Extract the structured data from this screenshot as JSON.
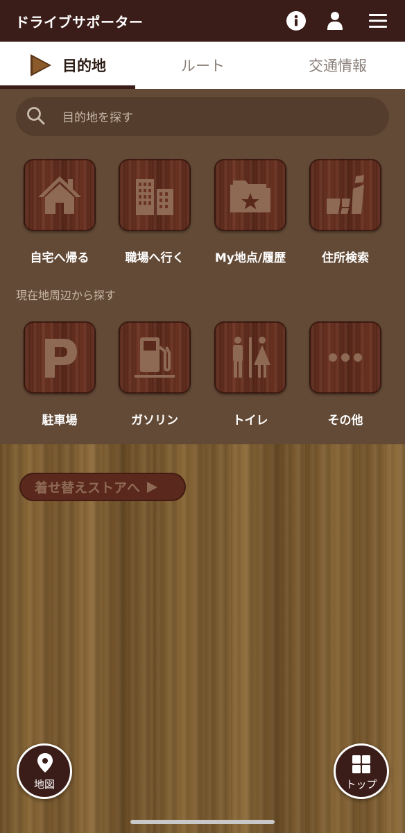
{
  "header": {
    "title": "ドライブサポーター",
    "icons": [
      "info-icon",
      "user-icon",
      "menu-icon"
    ]
  },
  "tabs": [
    {
      "label": "目的地",
      "selected": true
    },
    {
      "label": "ルート",
      "selected": false
    },
    {
      "label": "交通情報",
      "selected": false
    }
  ],
  "search": {
    "placeholder": "目的地を探す"
  },
  "quick_menu": [
    {
      "label": "自宅へ帰る",
      "icon": "house-icon"
    },
    {
      "label": "職場へ行く",
      "icon": "office-building-icon"
    },
    {
      "label": "My地点/履歴",
      "icon": "folder-star-icon"
    },
    {
      "label": "住所検索",
      "icon": "address-map-icon"
    }
  ],
  "nearby": {
    "section_label": "現在地周辺から探す",
    "items": [
      {
        "label": "駐車場",
        "icon": "parking-icon"
      },
      {
        "label": "ガソリン",
        "icon": "gas-station-icon"
      },
      {
        "label": "トイレ",
        "icon": "restroom-icon"
      },
      {
        "label": "その他",
        "icon": "more-icon"
      }
    ]
  },
  "store_button": {
    "label": "着せ替えストアへ"
  },
  "bottom": {
    "map_label": "地図",
    "top_label": "トップ"
  },
  "colors": {
    "header_bg": "#3a1c18",
    "panel_bg": "#634a36",
    "tile_wood": "#6e3423",
    "icon_engrave": "#8e6a55"
  }
}
